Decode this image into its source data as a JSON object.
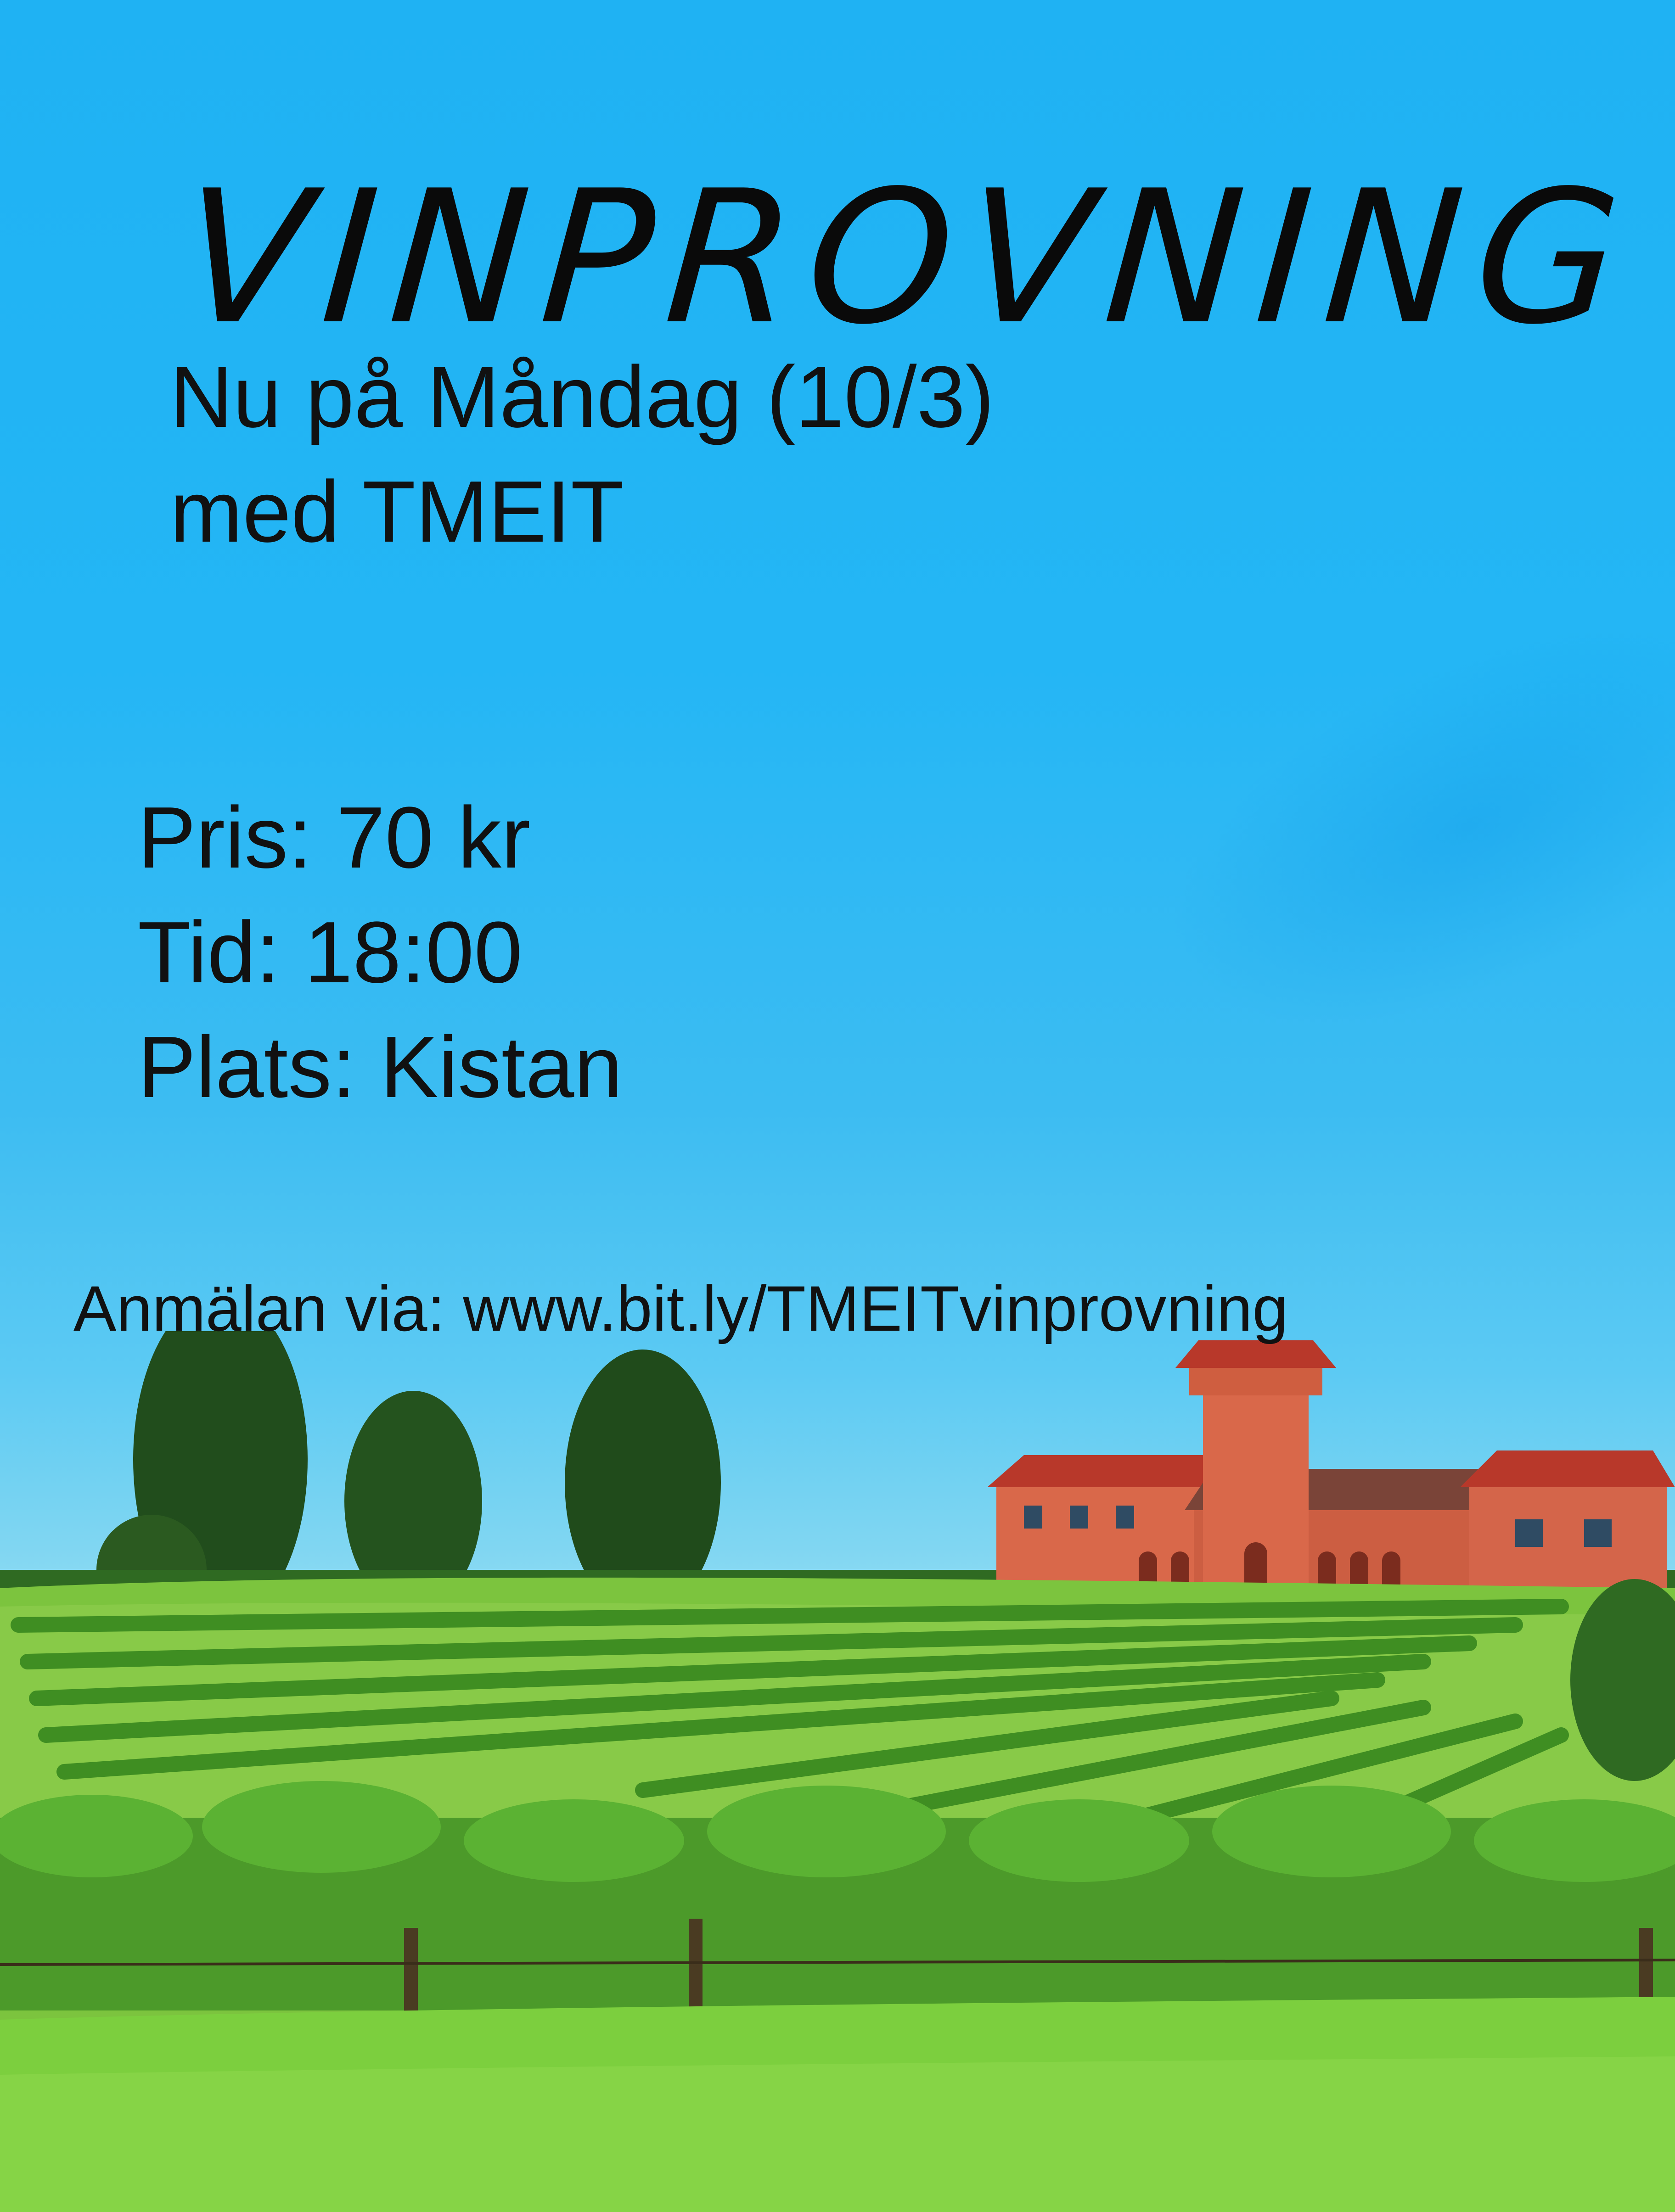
{
  "poster": {
    "title": "VINPROVNING",
    "subtitle_lines": [
      "Nu på Måndag (10/3)",
      "med TMEIT"
    ],
    "details": {
      "price": "Pris: 70 kr",
      "time": "Tid: 18:00",
      "place": "Plats: Kistan"
    },
    "signup": "Anmälan via: www.bit.ly/TMEITvinprovning"
  },
  "colors": {
    "sky_top": "#1fb2f3",
    "grass": "#6ec23a",
    "vines": "#3f8e22",
    "building_wall": "#d9684a",
    "building_roof": "#b8382a",
    "text": "#111111"
  }
}
